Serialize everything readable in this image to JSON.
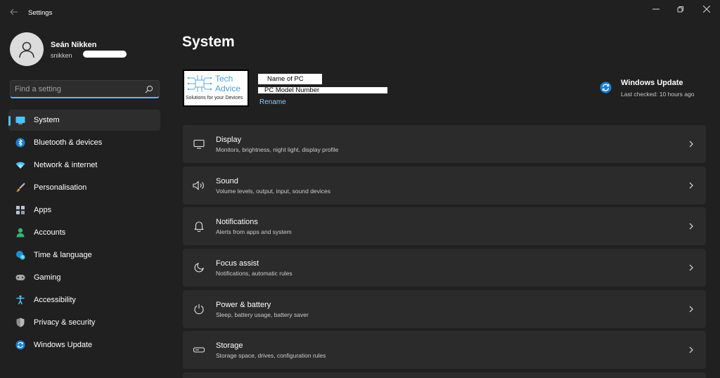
{
  "window": {
    "title": "Settings"
  },
  "profile": {
    "name": "Seán Nikken",
    "email": "snikken"
  },
  "search": {
    "placeholder": "Find a setting"
  },
  "sidebar": {
    "items": [
      {
        "label": "System",
        "icon": "system-icon",
        "selected": true
      },
      {
        "label": "Bluetooth & devices",
        "icon": "bluetooth-icon"
      },
      {
        "label": "Network & internet",
        "icon": "wifi-icon"
      },
      {
        "label": "Personalisation",
        "icon": "brush-icon"
      },
      {
        "label": "Apps",
        "icon": "apps-icon"
      },
      {
        "label": "Accounts",
        "icon": "accounts-icon"
      },
      {
        "label": "Time & language",
        "icon": "time-language-icon"
      },
      {
        "label": "Gaming",
        "icon": "gaming-icon"
      },
      {
        "label": "Accessibility",
        "icon": "accessibility-icon"
      },
      {
        "label": "Privacy & security",
        "icon": "shield-icon"
      },
      {
        "label": "Windows Update",
        "icon": "windows-update-icon"
      }
    ]
  },
  "main": {
    "title": "System",
    "device": {
      "logo_line1": "Tech",
      "logo_line2": "Advice",
      "logo_tagline": "Solutions for your Devices",
      "pc_name": "Name of PC",
      "pc_model": "PC Model Number",
      "rename_label": "Rename"
    },
    "windows_update": {
      "title": "Windows Update",
      "status": "Last checked: 10 hours ago"
    },
    "cards": [
      {
        "title": "Display",
        "desc": "Monitors, brightness, night light, display profile",
        "icon": "monitor-icon"
      },
      {
        "title": "Sound",
        "desc": "Volume levels, output, input, sound devices",
        "icon": "speaker-icon"
      },
      {
        "title": "Notifications",
        "desc": "Alerts from apps and system",
        "icon": "bell-icon"
      },
      {
        "title": "Focus assist",
        "desc": "Notifications, automatic rules",
        "icon": "moon-icon"
      },
      {
        "title": "Power & battery",
        "desc": "Sleep, battery usage, battery saver",
        "icon": "power-icon"
      },
      {
        "title": "Storage",
        "desc": "Storage space, drives, configuration rules",
        "icon": "drive-icon"
      }
    ]
  },
  "colors": {
    "background": "#202020",
    "card": "#2b2b2b",
    "accent": "#4cc2ff",
    "link": "#8ecdf8"
  }
}
